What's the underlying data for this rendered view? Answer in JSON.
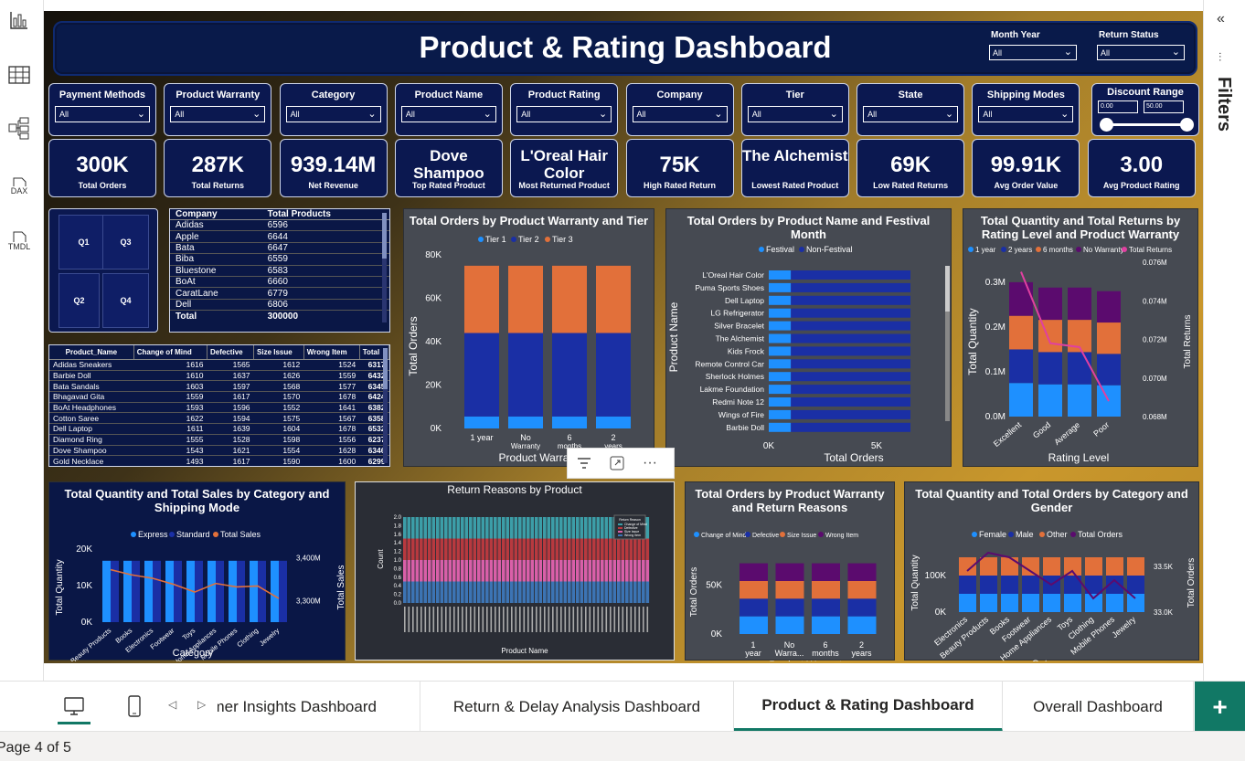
{
  "title": "Product & Rating Dashboard",
  "top_slicers": [
    {
      "label": "Month Year",
      "value": "All"
    },
    {
      "label": "Return Status",
      "value": "All"
    }
  ],
  "slicers": [
    {
      "label": "Payment Methods",
      "value": "All"
    },
    {
      "label": "Product Warranty",
      "value": "All"
    },
    {
      "label": "Category",
      "value": "All"
    },
    {
      "label": "Product Name",
      "value": "All"
    },
    {
      "label": "Product Rating",
      "value": "All"
    },
    {
      "label": "Company",
      "value": "All"
    },
    {
      "label": "Tier",
      "value": "All"
    },
    {
      "label": "State",
      "value": "All"
    },
    {
      "label": "Shipping Modes",
      "value": "All"
    }
  ],
  "discount": {
    "label": "Discount Range",
    "min": "0.00",
    "max": "50.00"
  },
  "kpis": [
    {
      "value": "300K",
      "label": "Total Orders"
    },
    {
      "value": "287K",
      "label": "Total Returns"
    },
    {
      "value": "939.14M",
      "label": "Net Revenue"
    },
    {
      "value": "Dove Shampoo",
      "label": "Top Rated Product"
    },
    {
      "value": "L'Oreal Hair Color",
      "label": "Most Returned Product"
    },
    {
      "value": "75K",
      "label": "High Rated Return"
    },
    {
      "value": "The Alchemist",
      "label": "Lowest Rated Product"
    },
    {
      "value": "69K",
      "label": "Low Rated Returns"
    },
    {
      "value": "99.91K",
      "label": "Avg Order Value"
    },
    {
      "value": "3.00",
      "label": "Avg Product Rating"
    }
  ],
  "quarters": [
    "Q1",
    "Q3",
    "Q2",
    "Q4"
  ],
  "company_table": {
    "headers": [
      "Company",
      "Total Products"
    ],
    "rows": [
      [
        "Adidas",
        "6596"
      ],
      [
        "Apple",
        "6644"
      ],
      [
        "Bata",
        "6647"
      ],
      [
        "Biba",
        "6559"
      ],
      [
        "Bluestone",
        "6583"
      ],
      [
        "BoAt",
        "6660"
      ],
      [
        "CaratLane",
        "6779"
      ],
      [
        "Dell",
        "6806"
      ]
    ],
    "total": [
      "Total",
      "300000"
    ]
  },
  "returns_table": {
    "headers": [
      "Product_Name",
      "Change of Mind",
      "Defective",
      "Size Issue",
      "Wrong Item",
      "Total"
    ],
    "rows": [
      [
        "Adidas Sneakers",
        "1616",
        "1565",
        "1612",
        "1524",
        "6317"
      ],
      [
        "Barbie Doll",
        "1610",
        "1637",
        "1626",
        "1559",
        "6432"
      ],
      [
        "Bata Sandals",
        "1603",
        "1597",
        "1568",
        "1577",
        "6345"
      ],
      [
        "Bhagavad Gita",
        "1559",
        "1617",
        "1570",
        "1678",
        "6424"
      ],
      [
        "BoAt Headphones",
        "1593",
        "1596",
        "1552",
        "1641",
        "6382"
      ],
      [
        "Cotton Saree",
        "1622",
        "1594",
        "1575",
        "1567",
        "6358"
      ],
      [
        "Dell Laptop",
        "1611",
        "1639",
        "1604",
        "1678",
        "6532"
      ],
      [
        "Diamond Ring",
        "1555",
        "1528",
        "1598",
        "1556",
        "6237"
      ],
      [
        "Dove Shampoo",
        "1543",
        "1621",
        "1554",
        "1628",
        "6346"
      ],
      [
        "Gold Necklace",
        "1493",
        "1617",
        "1590",
        "1600",
        "6299"
      ]
    ]
  },
  "charts": {
    "warranty_tier": {
      "title": "Total Orders by Product Warranty and Tier",
      "legend": [
        "Tier 1",
        "Tier 2",
        "Tier 3"
      ],
      "ylabel": "Total Orders",
      "xlabel": "Product Warranty",
      "yticks": [
        "0K",
        "20K",
        "40K",
        "60K",
        "80K"
      ],
      "xticks": [
        "1 year",
        "No Warranty",
        "6 months",
        "2 years"
      ]
    },
    "festival": {
      "title": "Total Orders by Product Name and Festival Month",
      "legend": [
        "Festival",
        "Non-Festival"
      ],
      "ylabel": "Product Name",
      "xlabel": "Total Orders",
      "xticks": [
        "0K",
        "5K"
      ]
    },
    "rating": {
      "title": "Total Quantity and Total Returns by Rating Level and Product Warranty",
      "legend": [
        "1 year",
        "2 years",
        "6 months",
        "No Warranty",
        "Total Returns"
      ],
      "ylabel": "Total Quantity",
      "y2label": "Total Returns",
      "xlabel": "Rating Level",
      "yticks": [
        "0.0M",
        "0.1M",
        "0.2M",
        "0.3M"
      ],
      "y2ticks": [
        "0.068M",
        "0.070M",
        "0.072M",
        "0.074M",
        "0.076M"
      ]
    },
    "shipping": {
      "title": "Total Quantity and Total Sales by Category and Shipping Mode",
      "legend": [
        "Express",
        "Standard",
        "Total Sales"
      ],
      "ylabel": "Total Quantity",
      "y2label": "Total Sales",
      "xlabel": "Category",
      "yticks": [
        "0K",
        "10K",
        "20K"
      ],
      "y2ticks": [
        "3,300M",
        "3,400M"
      ]
    },
    "reasons": {
      "title": "Return Reasons by Product",
      "ylabel": "Count",
      "xlabel": "Product Name",
      "yticks": [
        "0.0",
        "0.2",
        "0.4",
        "0.6",
        "0.8",
        "1.0",
        "1.2",
        "1.4",
        "1.6",
        "1.8",
        "2.0"
      ],
      "legend_title": "Return Reason",
      "legend": [
        "Change of Mind",
        "Defective",
        "Size Issue",
        "Wrong Item"
      ]
    },
    "warranty_reasons": {
      "title": "Total Orders by Product Warranty and Return Reasons",
      "legend": [
        "Change of Mind",
        "Defective",
        "Size Issue",
        "Wrong Item"
      ],
      "ylabel": "Total Orders",
      "xlabel": "Product Warranty",
      "yticks": [
        "0K",
        "50K"
      ],
      "xticks": [
        "1 year",
        "No Warra...",
        "6 months",
        "2 years"
      ]
    },
    "gender": {
      "title": "Total Quantity and Total Orders by Category and Gender",
      "legend": [
        "Female",
        "Male",
        "Other",
        "Total Orders"
      ],
      "ylabel": "Total Quantity",
      "y2label": "Total Orders",
      "xlabel": "Category",
      "yticks": [
        "0K",
        "100K"
      ],
      "y2ticks": [
        "33.0K",
        "33.5K"
      ]
    }
  },
  "chart_data": [
    {
      "type": "bar",
      "title": "Total Orders by Product Warranty and Tier",
      "categories": [
        "1 year",
        "No Warranty",
        "6 months",
        "2 years"
      ],
      "series": [
        {
          "name": "Tier 1",
          "values": [
            5500,
            5500,
            5500,
            5500
          ]
        },
        {
          "name": "Tier 2",
          "values": [
            38500,
            38500,
            38500,
            38500
          ]
        },
        {
          "name": "Tier 3",
          "values": [
            31000,
            31000,
            31000,
            31000
          ]
        }
      ],
      "ylim": [
        0,
        80000
      ]
    },
    {
      "type": "bar",
      "title": "Total Orders by Product Name and Festival Month",
      "orientation": "horizontal",
      "categories": [
        "L'Oreal Hair Color",
        "Puma Sports Shoes",
        "Dell Laptop",
        "LG Refrigerator",
        "Silver Bracelet",
        "The Alchemist",
        "Kids Frock",
        "Remote Control Car",
        "Sherlock Holmes",
        "Lakme Foundation",
        "Redmi Note 12",
        "Wings of Fire",
        "Barbie Doll"
      ],
      "series": [
        {
          "name": "Festival",
          "values": [
            1000,
            1000,
            1000,
            1000,
            1000,
            1000,
            1000,
            1000,
            1000,
            1000,
            1000,
            1000,
            1000
          ]
        },
        {
          "name": "Non-Festival",
          "values": [
            5400,
            5400,
            5400,
            5400,
            5400,
            5400,
            5400,
            5400,
            5400,
            5400,
            5400,
            5400,
            5400
          ]
        }
      ]
    },
    {
      "type": "bar",
      "title": "Total Quantity and Total Returns by Rating Level and Product Warranty",
      "categories": [
        "Excellent",
        "Good",
        "Average",
        "Poor"
      ],
      "series": [
        {
          "name": "1 year",
          "values": [
            75000,
            72000,
            72000,
            70000
          ]
        },
        {
          "name": "2 years",
          "values": [
            75000,
            72000,
            72000,
            70000
          ]
        },
        {
          "name": "6 months",
          "values": [
            75000,
            72000,
            72000,
            70000
          ]
        },
        {
          "name": "No Warranty",
          "values": [
            75000,
            72000,
            72000,
            70000
          ]
        },
        {
          "name": "Total Returns",
          "values": [
            75500,
            71800,
            71600,
            68800
          ]
        }
      ]
    },
    {
      "type": "bar",
      "title": "Total Quantity and Total Sales by Category and Shipping Mode",
      "categories": [
        "Beauty Products",
        "Books",
        "Electronics",
        "Footwear",
        "Toys",
        "Home Appliances",
        "Mobile Phones",
        "Clothing",
        "Jewelry"
      ],
      "series": [
        {
          "name": "Express",
          "values": [
            16800,
            16800,
            16800,
            16800,
            16800,
            16800,
            16800,
            16800,
            16800
          ]
        },
        {
          "name": "Standard",
          "values": [
            16800,
            16800,
            16800,
            16800,
            16800,
            16800,
            16800,
            16800,
            16800
          ]
        },
        {
          "name": "Total Sales",
          "values": [
            3372,
            3360,
            3352,
            3338,
            3320,
            3340,
            3332,
            3334,
            3305
          ]
        }
      ],
      "ylim": [
        0,
        20000
      ],
      "y2lim": [
        3250,
        3420
      ]
    },
    {
      "type": "bar",
      "title": "Return Reasons by Product",
      "ylim": [
        0,
        2.0
      ],
      "series": [
        {
          "name": "Change of Mind",
          "values": [
            0.5
          ]
        },
        {
          "name": "Defective",
          "values": [
            0.5
          ]
        },
        {
          "name": "Size Issue",
          "values": [
            0.5
          ]
        },
        {
          "name": "Wrong Item",
          "values": [
            0.5
          ]
        }
      ]
    },
    {
      "type": "bar",
      "title": "Total Orders by Product Warranty and Return Reasons",
      "categories": [
        "1 year",
        "No Warranty",
        "6 months",
        "2 years"
      ],
      "series": [
        {
          "name": "Change of Mind",
          "values": [
            18000,
            18000,
            18000,
            18000
          ]
        },
        {
          "name": "Defective",
          "values": [
            18000,
            18000,
            18000,
            18000
          ]
        },
        {
          "name": "Size Issue",
          "values": [
            18000,
            18000,
            18000,
            18000
          ]
        },
        {
          "name": "Wrong Item",
          "values": [
            18000,
            18000,
            18000,
            18000
          ]
        }
      ],
      "ylim": [
        0,
        80000
      ]
    },
    {
      "type": "bar",
      "title": "Total Quantity and Total Orders by Category and Gender",
      "categories": [
        "Electronics",
        "Beauty Products",
        "Books",
        "Footwear",
        "Home Appliances",
        "Toys",
        "Clothing",
        "Mobile Phones",
        "Jewelry"
      ],
      "series": [
        {
          "name": "Female",
          "values": [
            50000,
            50000,
            50000,
            50000,
            50000,
            50000,
            50000,
            50000,
            50000
          ]
        },
        {
          "name": "Male",
          "values": [
            50000,
            50000,
            50000,
            50000,
            50000,
            50000,
            50000,
            50000,
            50000
          ]
        },
        {
          "name": "Other",
          "values": [
            50000,
            50000,
            50000,
            50000,
            50000,
            50000,
            50000,
            50000,
            50000
          ]
        },
        {
          "name": "Total Orders",
          "values": [
            33450,
            33650,
            33600,
            33450,
            33300,
            33450,
            33150,
            33350,
            33150
          ]
        }
      ]
    }
  ],
  "tabs": [
    "Customer Insights Dashboard",
    "Return & Delay Analysis Dashboard",
    "Product & Rating Dashboard",
    "Overall Dashboard"
  ],
  "active_tab": "Product & Rating Dashboard",
  "status": "Page 4 of 5",
  "filters_label": "Filters",
  "left_icons": [
    "DAX",
    "TMDL"
  ],
  "colors": {
    "navy": "#0b1850",
    "tier1": "#1e90ff",
    "tier2": "#1a2fa5",
    "tier3": "#e2703a",
    "purple": "#5b0b6e",
    "pink": "#e040a0",
    "accent": "#117865"
  }
}
